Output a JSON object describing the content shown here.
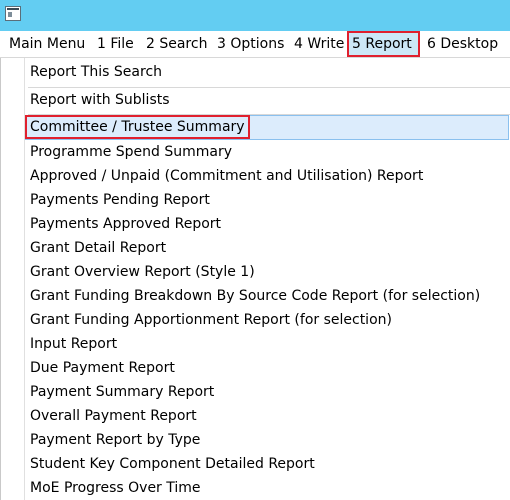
{
  "menubar": {
    "items": [
      {
        "label": "Main Menu"
      },
      {
        "label": "1 File"
      },
      {
        "label": "2 Search"
      },
      {
        "label": "3 Options"
      },
      {
        "label": "4 Write"
      },
      {
        "label": "5 Report",
        "active": true
      },
      {
        "label": "6 Desktop"
      }
    ]
  },
  "report_menu": {
    "items": [
      {
        "label": "Report This Search"
      },
      {
        "label": "Report with Sublists"
      },
      {
        "label": "Committee / Trustee Summary",
        "selected": true
      },
      {
        "label": "Programme Spend Summary"
      },
      {
        "label": "Approved / Unpaid (Commitment and Utilisation) Report"
      },
      {
        "label": "Payments Pending Report"
      },
      {
        "label": "Payments Approved Report"
      },
      {
        "label": "Grant Detail Report"
      },
      {
        "label": "Grant Overview Report (Style 1)"
      },
      {
        "label": "Grant Funding Breakdown By Source Code Report (for selection)"
      },
      {
        "label": "Grant Funding Apportionment Report (for selection)"
      },
      {
        "label": "Input Report"
      },
      {
        "label": "Due Payment Report"
      },
      {
        "label": "Payment Summary Report"
      },
      {
        "label": "Overall Payment Report"
      },
      {
        "label": "Payment Report by Type"
      },
      {
        "label": "Student Key Component Detailed Report"
      },
      {
        "label": "MoE Progress Over Time"
      }
    ]
  },
  "colors": {
    "titlebar": "#63cdf2",
    "highlight_border": "#e0202e",
    "selected_row": "#dcecfc",
    "active_menu": "#cce8f7"
  },
  "icons": {
    "app": "application-window-icon"
  }
}
